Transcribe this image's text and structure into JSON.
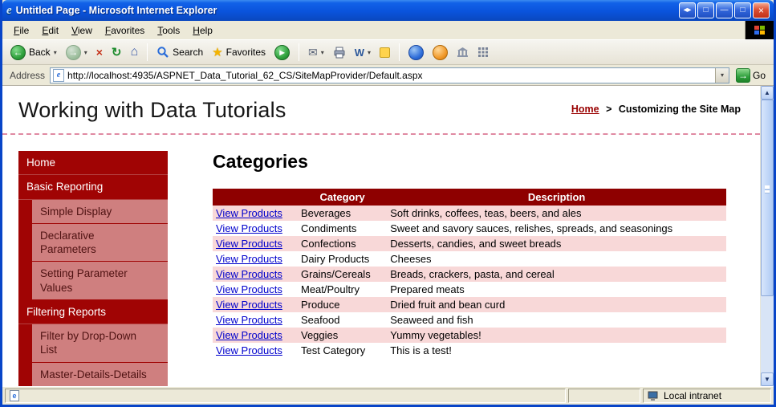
{
  "window": {
    "title": "Untitled Page - Microsoft Internet Explorer"
  },
  "menu": {
    "items": [
      "File",
      "Edit",
      "View",
      "Favorites",
      "Tools",
      "Help"
    ]
  },
  "toolbar": {
    "back": "Back",
    "search": "Search",
    "favorites": "Favorites"
  },
  "address": {
    "label": "Address",
    "url": "http://localhost:4935/ASPNET_Data_Tutorial_62_CS/SiteMapProvider/Default.aspx",
    "go": "Go"
  },
  "page": {
    "title": "Working with Data Tutorials",
    "breadcrumb": {
      "home": "Home",
      "separator": ">",
      "current": "Customizing the Site Map"
    },
    "sidebar": {
      "items": [
        {
          "label": "Home",
          "level": 1
        },
        {
          "label": "Basic Reporting",
          "level": 1
        },
        {
          "label": "Simple Display",
          "level": 2
        },
        {
          "label": "Declarative Parameters",
          "level": 2
        },
        {
          "label": "Setting Parameter Values",
          "level": 2
        },
        {
          "label": "Filtering Reports",
          "level": 1
        },
        {
          "label": "Filter by Drop-Down List",
          "level": 2
        },
        {
          "label": "Master-Details-Details",
          "level": 2
        }
      ]
    },
    "main": {
      "heading": "Categories",
      "table": {
        "headers": [
          "",
          "Category",
          "Description"
        ],
        "link_label": "View Products",
        "rows": [
          {
            "category": "Beverages",
            "description": "Soft drinks, coffees, teas, beers, and ales"
          },
          {
            "category": "Condiments",
            "description": "Sweet and savory sauces, relishes, spreads, and seasonings"
          },
          {
            "category": "Confections",
            "description": "Desserts, candies, and sweet breads"
          },
          {
            "category": "Dairy Products",
            "description": "Cheeses"
          },
          {
            "category": "Grains/Cereals",
            "description": "Breads, crackers, pasta, and cereal"
          },
          {
            "category": "Meat/Poultry",
            "description": "Prepared meats"
          },
          {
            "category": "Produce",
            "description": "Dried fruit and bean curd"
          },
          {
            "category": "Seafood",
            "description": "Seaweed and fish"
          },
          {
            "category": "Veggies",
            "description": "Yummy vegetables!"
          },
          {
            "category": "Test Category",
            "description": "This is a test!"
          }
        ]
      }
    }
  },
  "status": {
    "zone": "Local intranet"
  },
  "icons": {
    "ie_e": "e",
    "titlebar_arrows": "◂▸",
    "win_box": "□",
    "minimize": "—",
    "maximize": "□",
    "close": "×",
    "back_arrow": "←",
    "forward_arrow": "→",
    "stop": "×",
    "refresh": "↻",
    "home": "⌂",
    "star": "★",
    "media_play": "▸",
    "mail": "✉",
    "word_w": "W",
    "dropdown": "▾",
    "go_arrow": "→",
    "scroll_up": "▲",
    "scroll_down": "▼"
  },
  "colors": {
    "titlebar_blue": "#0A53DC",
    "maroon": "#A00404",
    "table_header_red": "#8E0000",
    "salmon": "#CF7F7F",
    "row_pink": "#F8D8D8",
    "link_blue": "#0000CC",
    "breadcrumb_red": "#990000"
  }
}
